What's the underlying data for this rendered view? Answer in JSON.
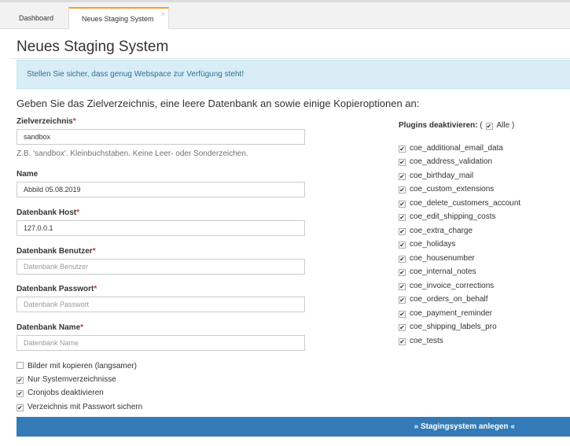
{
  "tabs": [
    {
      "label": "Dashboard"
    },
    {
      "label": "Neues Staging System",
      "close": "×"
    }
  ],
  "page": {
    "title": "Neues Staging System",
    "alert": "Stellen Sie sicher, dass genug Webspace zur Verfügung steht!",
    "instruction": "Geben Sie das Zielverzeichnis, eine leere Datenbank an sowie einige Kopieroptionen an:"
  },
  "form": {
    "fields": [
      {
        "label": "Zielverzeichnis",
        "required": "*",
        "value": "sandbox",
        "placeholder": ""
      },
      {
        "label": "Name",
        "required": "",
        "value": "Abbild 05.08.2019",
        "placeholder": ""
      },
      {
        "label": "Datenbank Host",
        "required": "*",
        "value": "127.0.0.1",
        "placeholder": ""
      },
      {
        "label": "Datenbank Benutzer",
        "required": "*",
        "value": "",
        "placeholder": "Datenbank Benutzer"
      },
      {
        "label": "Datenbank Passwort",
        "required": "*",
        "value": "",
        "placeholder": "Datenbank Passwort"
      },
      {
        "label": "Datenbank Name",
        "required": "*",
        "value": "",
        "placeholder": "Datenbank Name"
      }
    ],
    "help_text": "Z.B. 'sandbox'. Kleinbuchstaben. Keine Leer- oder Sonderzeichen.",
    "options": [
      {
        "label": "Bilder mit kopieren (langsamer)",
        "checked": false
      },
      {
        "label": "Nur Systemverzeichnisse",
        "checked": true
      },
      {
        "label": "Cronjobs deaktivieren",
        "checked": true
      },
      {
        "label": "Verzeichnis mit Passwort sichern",
        "checked": true
      }
    ],
    "submit_label": "» Stagingsystem anlegen «"
  },
  "plugins": {
    "heading": "Plugins deaktivieren:",
    "all_open": "(",
    "all_label": "Alle )",
    "items": [
      "coe_additional_email_data",
      "coe_address_validation",
      "coe_birthday_mail",
      "coe_custom_extensions",
      "coe_delete_customers_account",
      "coe_edit_shipping_costs",
      "coe_extra_charge",
      "coe_holidays",
      "coe_housenumber",
      "coe_internal_notes",
      "coe_invoice_corrections",
      "coe_orders_on_behalf",
      "coe_payment_reminder",
      "coe_shipping_labels_pro",
      "coe_tests"
    ]
  }
}
